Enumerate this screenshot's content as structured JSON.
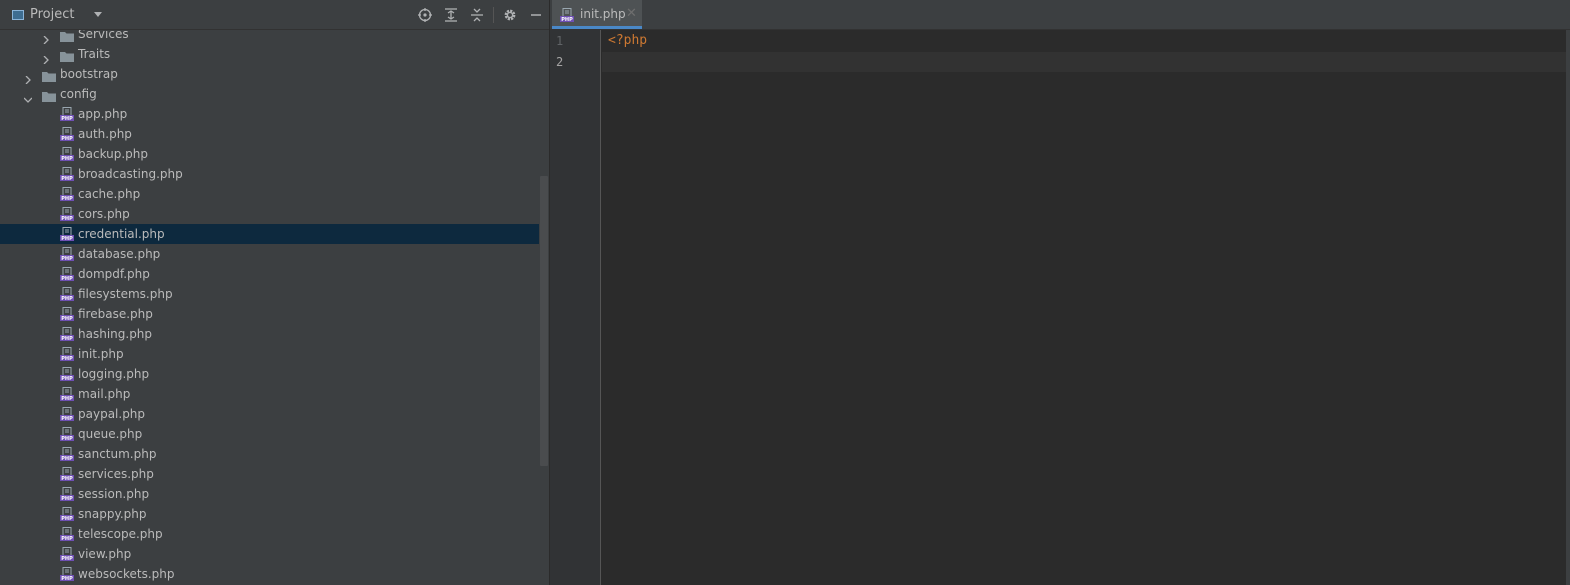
{
  "project_panel": {
    "title": "Project",
    "tools": [
      "locate-icon",
      "expand-all-icon",
      "collapse-all-icon",
      "gear-icon",
      "minimize-icon"
    ]
  },
  "tree": [
    {
      "type": "folder",
      "label": "Services",
      "depth": 2,
      "expanded": false
    },
    {
      "type": "folder",
      "label": "Traits",
      "depth": 2,
      "expanded": false
    },
    {
      "type": "folder",
      "label": "bootstrap",
      "depth": 1,
      "expanded": false
    },
    {
      "type": "folder",
      "label": "config",
      "depth": 1,
      "expanded": true
    },
    {
      "type": "file",
      "label": "app.php"
    },
    {
      "type": "file",
      "label": "auth.php"
    },
    {
      "type": "file",
      "label": "backup.php"
    },
    {
      "type": "file",
      "label": "broadcasting.php"
    },
    {
      "type": "file",
      "label": "cache.php"
    },
    {
      "type": "file",
      "label": "cors.php"
    },
    {
      "type": "file",
      "label": "credential.php",
      "selected": true
    },
    {
      "type": "file",
      "label": "database.php"
    },
    {
      "type": "file",
      "label": "dompdf.php"
    },
    {
      "type": "file",
      "label": "filesystems.php"
    },
    {
      "type": "file",
      "label": "firebase.php"
    },
    {
      "type": "file",
      "label": "hashing.php"
    },
    {
      "type": "file",
      "label": "init.php"
    },
    {
      "type": "file",
      "label": "logging.php"
    },
    {
      "type": "file",
      "label": "mail.php"
    },
    {
      "type": "file",
      "label": "paypal.php"
    },
    {
      "type": "file",
      "label": "queue.php"
    },
    {
      "type": "file",
      "label": "sanctum.php"
    },
    {
      "type": "file",
      "label": "services.php"
    },
    {
      "type": "file",
      "label": "session.php"
    },
    {
      "type": "file",
      "label": "snappy.php"
    },
    {
      "type": "file",
      "label": "telescope.php"
    },
    {
      "type": "file",
      "label": "view.php"
    },
    {
      "type": "file",
      "label": "websockets.php"
    }
  ],
  "editor": {
    "tab_label": "init.php",
    "tab_close": "✕",
    "line_numbers": [
      "1",
      "2"
    ],
    "code_lines": [
      "<?php",
      ""
    ]
  },
  "colors": {
    "panel_bg": "#3c3f41",
    "editor_bg": "#2b2b2b",
    "selection_bg": "#0d293e",
    "php_tag": "#cc7832",
    "tab_underline": "#4a88c7"
  }
}
